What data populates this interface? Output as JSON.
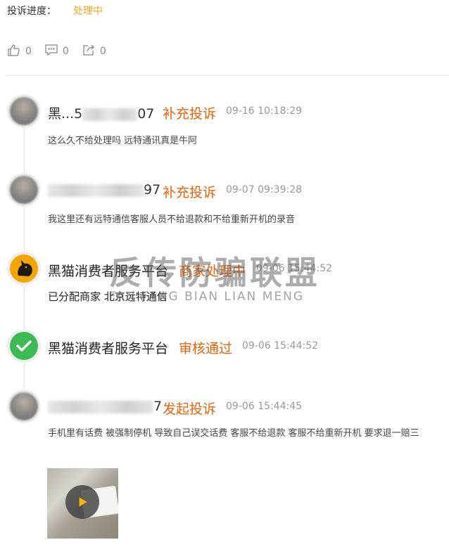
{
  "progress": {
    "label": "投诉进度：",
    "status": "处理中",
    "status_color": "#f5a623"
  },
  "actions": [
    {
      "icon": "thumbs-up-icon",
      "count": "0"
    },
    {
      "icon": "comment-icon",
      "count": "0"
    },
    {
      "icon": "share-icon",
      "count": "0"
    }
  ],
  "timeline": [
    {
      "name_prefix": "黑...5",
      "name_suffix": "07",
      "action": "补充投诉",
      "time": "09-16 10:18:29",
      "text": "这么久不给处理吗 远特通讯真是牛阿"
    },
    {
      "name_prefix": "",
      "name_suffix": "97",
      "action": "补充投诉",
      "time": "09-07 09:39:28",
      "text": "我这里还有远特通信客服人员不给退款和不给重新开机的录音"
    },
    {
      "name": "黑猫消费者服务平台",
      "action": "商家处理中",
      "time": "09-06 15:44:52",
      "text": "已分配商家 北京远特通信"
    },
    {
      "name": "黑猫消费者服务平台",
      "action": "审核通过",
      "time": "09-06 15:44:52"
    },
    {
      "name_prefix": "",
      "name_suffix": "7",
      "action": "发起投诉",
      "time": "09-06 15:44:45",
      "text": "手机里有话费 被强制停机 导致自己误交话费 客服不给退款 客服不给重新开机 要求退一赔三"
    }
  ],
  "watermark": {
    "cn": "反传防骗联盟",
    "en": "FAN FANG BIAN LIAN MENG"
  },
  "colors": {
    "accent": "#e8620c",
    "check_green": "#3cba54",
    "cat_orange": "#f5a500"
  }
}
